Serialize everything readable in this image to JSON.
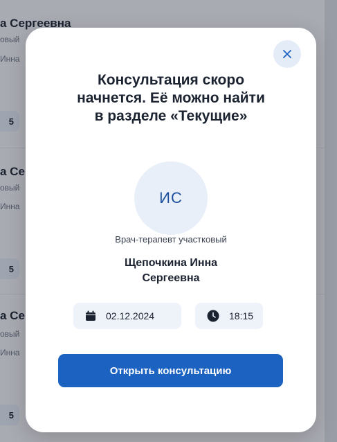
{
  "background": {
    "items": [
      {
        "name": "а Сергеевна",
        "role": "овый",
        "doctor": "Инна"
      },
      {
        "name": "а Се",
        "role": "овый",
        "doctor": "Инна"
      },
      {
        "name": "а Се",
        "role": "овый",
        "doctor": "Инна"
      }
    ],
    "chips": [
      "5",
      "5",
      "5"
    ]
  },
  "modal": {
    "close_label": "×",
    "title_lines": [
      "Консультация скоро",
      "начнется. Её можно найти",
      "в разделе «Текущие»"
    ],
    "avatar_initials": "ИС",
    "specialty": "Врач-терапевт участковый",
    "doctor_lines": [
      "Щепочкина Инна",
      "Сергеевна"
    ],
    "date": "02.12.2024",
    "time": "18:15",
    "open_button": "Открыть консультацию"
  },
  "colors": {
    "primary": "#1c62c0",
    "avatar_bg": "#e8eff9",
    "chip_bg": "#eef3fa"
  },
  "icons": [
    "close-icon",
    "calendar-icon",
    "clock-icon"
  ]
}
